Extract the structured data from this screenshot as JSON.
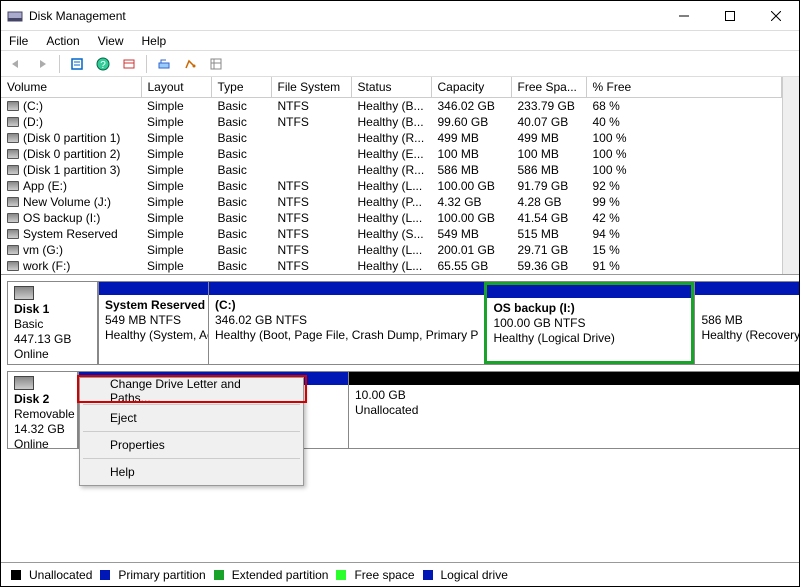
{
  "window": {
    "title": "Disk Management"
  },
  "menus": {
    "file": "File",
    "action": "Action",
    "view": "View",
    "help": "Help"
  },
  "table": {
    "headers": {
      "volume": "Volume",
      "layout": "Layout",
      "type": "Type",
      "filesystem": "File System",
      "status": "Status",
      "capacity": "Capacity",
      "freespace": "Free Spa...",
      "pctfree": "% Free"
    },
    "rows": [
      {
        "volume": "(C:)",
        "layout": "Simple",
        "type": "Basic",
        "fs": "NTFS",
        "status": "Healthy (B...",
        "capacity": "346.02 GB",
        "free": "233.79 GB",
        "pct": "68 %"
      },
      {
        "volume": "(D:)",
        "layout": "Simple",
        "type": "Basic",
        "fs": "NTFS",
        "status": "Healthy (B...",
        "capacity": "99.60 GB",
        "free": "40.07 GB",
        "pct": "40 %"
      },
      {
        "volume": "(Disk 0 partition 1)",
        "layout": "Simple",
        "type": "Basic",
        "fs": "",
        "status": "Healthy (R...",
        "capacity": "499 MB",
        "free": "499 MB",
        "pct": "100 %"
      },
      {
        "volume": "(Disk 0 partition 2)",
        "layout": "Simple",
        "type": "Basic",
        "fs": "",
        "status": "Healthy (E...",
        "capacity": "100 MB",
        "free": "100 MB",
        "pct": "100 %"
      },
      {
        "volume": "(Disk 1 partition 3)",
        "layout": "Simple",
        "type": "Basic",
        "fs": "",
        "status": "Healthy (R...",
        "capacity": "586 MB",
        "free": "586 MB",
        "pct": "100 %"
      },
      {
        "volume": "App (E:)",
        "layout": "Simple",
        "type": "Basic",
        "fs": "NTFS",
        "status": "Healthy (L...",
        "capacity": "100.00 GB",
        "free": "91.79 GB",
        "pct": "92 %"
      },
      {
        "volume": "New Volume (J:)",
        "layout": "Simple",
        "type": "Basic",
        "fs": "NTFS",
        "status": "Healthy (P...",
        "capacity": "4.32 GB",
        "free": "4.28 GB",
        "pct": "99 %"
      },
      {
        "volume": "OS backup (I:)",
        "layout": "Simple",
        "type": "Basic",
        "fs": "NTFS",
        "status": "Healthy (L...",
        "capacity": "100.00 GB",
        "free": "41.54 GB",
        "pct": "42 %"
      },
      {
        "volume": "System Reserved",
        "layout": "Simple",
        "type": "Basic",
        "fs": "NTFS",
        "status": "Healthy (S...",
        "capacity": "549 MB",
        "free": "515 MB",
        "pct": "94 %"
      },
      {
        "volume": "vm (G:)",
        "layout": "Simple",
        "type": "Basic",
        "fs": "NTFS",
        "status": "Healthy (L...",
        "capacity": "200.01 GB",
        "free": "29.71 GB",
        "pct": "15 %"
      },
      {
        "volume": "work (F:)",
        "layout": "Simple",
        "type": "Basic",
        "fs": "NTFS",
        "status": "Healthy (L...",
        "capacity": "65.55 GB",
        "free": "59.36 GB",
        "pct": "91 %"
      }
    ]
  },
  "disks": {
    "disk1": {
      "title": "Disk 1",
      "type": "Basic",
      "size": "447.13 GB",
      "state": "Online",
      "parts": [
        {
          "name": "System Reserved",
          "line2": "549 MB NTFS",
          "line3": "Healthy (System, Activ",
          "color": "blue"
        },
        {
          "name": "(C:)",
          "line2": "346.02 GB NTFS",
          "line3": "Healthy (Boot, Page File, Crash Dump, Primary P",
          "color": "blue"
        },
        {
          "name": "OS backup  (I:)",
          "line2": "100.00 GB NTFS",
          "line3": "Healthy (Logical Drive)",
          "color": "blue",
          "highlight": "green"
        },
        {
          "name": "",
          "line2": "586 MB",
          "line3": "Healthy (Recovery Part",
          "color": "blue"
        }
      ]
    },
    "disk2": {
      "title": "Disk 2",
      "type": "Removable",
      "size": "14.32 GB",
      "state": "Online",
      "parts": [
        {
          "name": "",
          "line2": "",
          "line3": "",
          "color": "blue"
        },
        {
          "name": "",
          "line2": "10.00 GB",
          "line3": "Unallocated",
          "color": "black"
        }
      ]
    }
  },
  "ctxmenu": {
    "item1": "Change Drive Letter and Paths...",
    "item2": "Eject",
    "item3": "Properties",
    "item4": "Help"
  },
  "legend": {
    "unallocated": "Unallocated",
    "primary": "Primary partition",
    "extended": "Extended partition",
    "freespace": "Free space",
    "logical": "Logical drive"
  }
}
